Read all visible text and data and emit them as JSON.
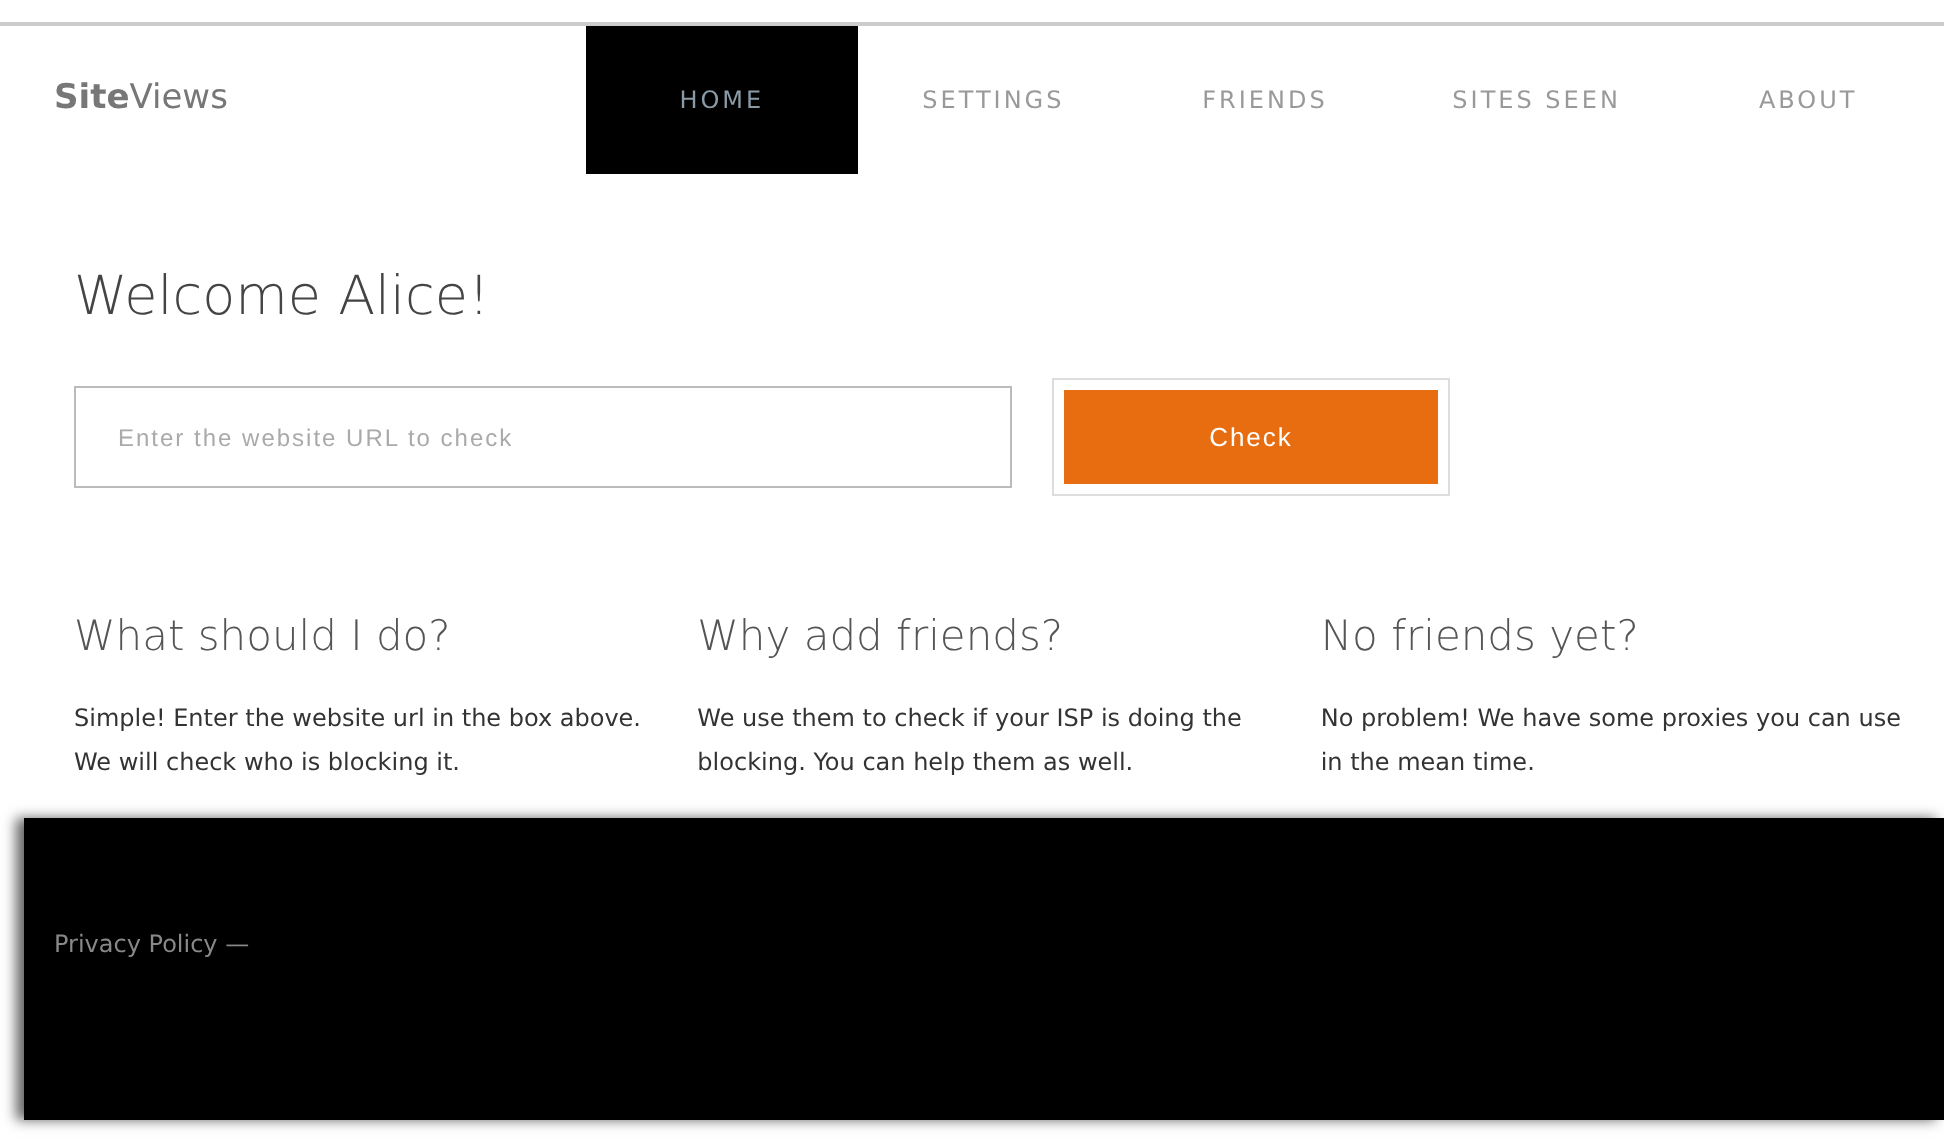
{
  "brand": "**Site**Views",
  "nav": [
    {
      "label": "HOME",
      "selected": true
    },
    {
      "label": "SETTINGS",
      "selected": false
    },
    {
      "label": "FRIENDS",
      "selected": false
    },
    {
      "label": "SITES SEEN",
      "selected": false
    },
    {
      "label": "ABOUT",
      "selected": false
    }
  ],
  "heading": "Welcome Alice!",
  "url_field": {
    "placeholder": "Enter the website URL to check"
  },
  "check_button": "Check",
  "columns": [
    {
      "title": "What should I do?",
      "text": "Simple! Enter the website url in the box above. We will check who is blocking it."
    },
    {
      "title": "Why add friends?",
      "text": "We use them to check if your ISP is doing the blocking. You can help them as well."
    },
    {
      "title": "No friends yet?",
      "text": "No problem! We have some proxies you can use in the mean time."
    }
  ],
  "footer": {
    "link": "Privacy Policy —"
  }
}
